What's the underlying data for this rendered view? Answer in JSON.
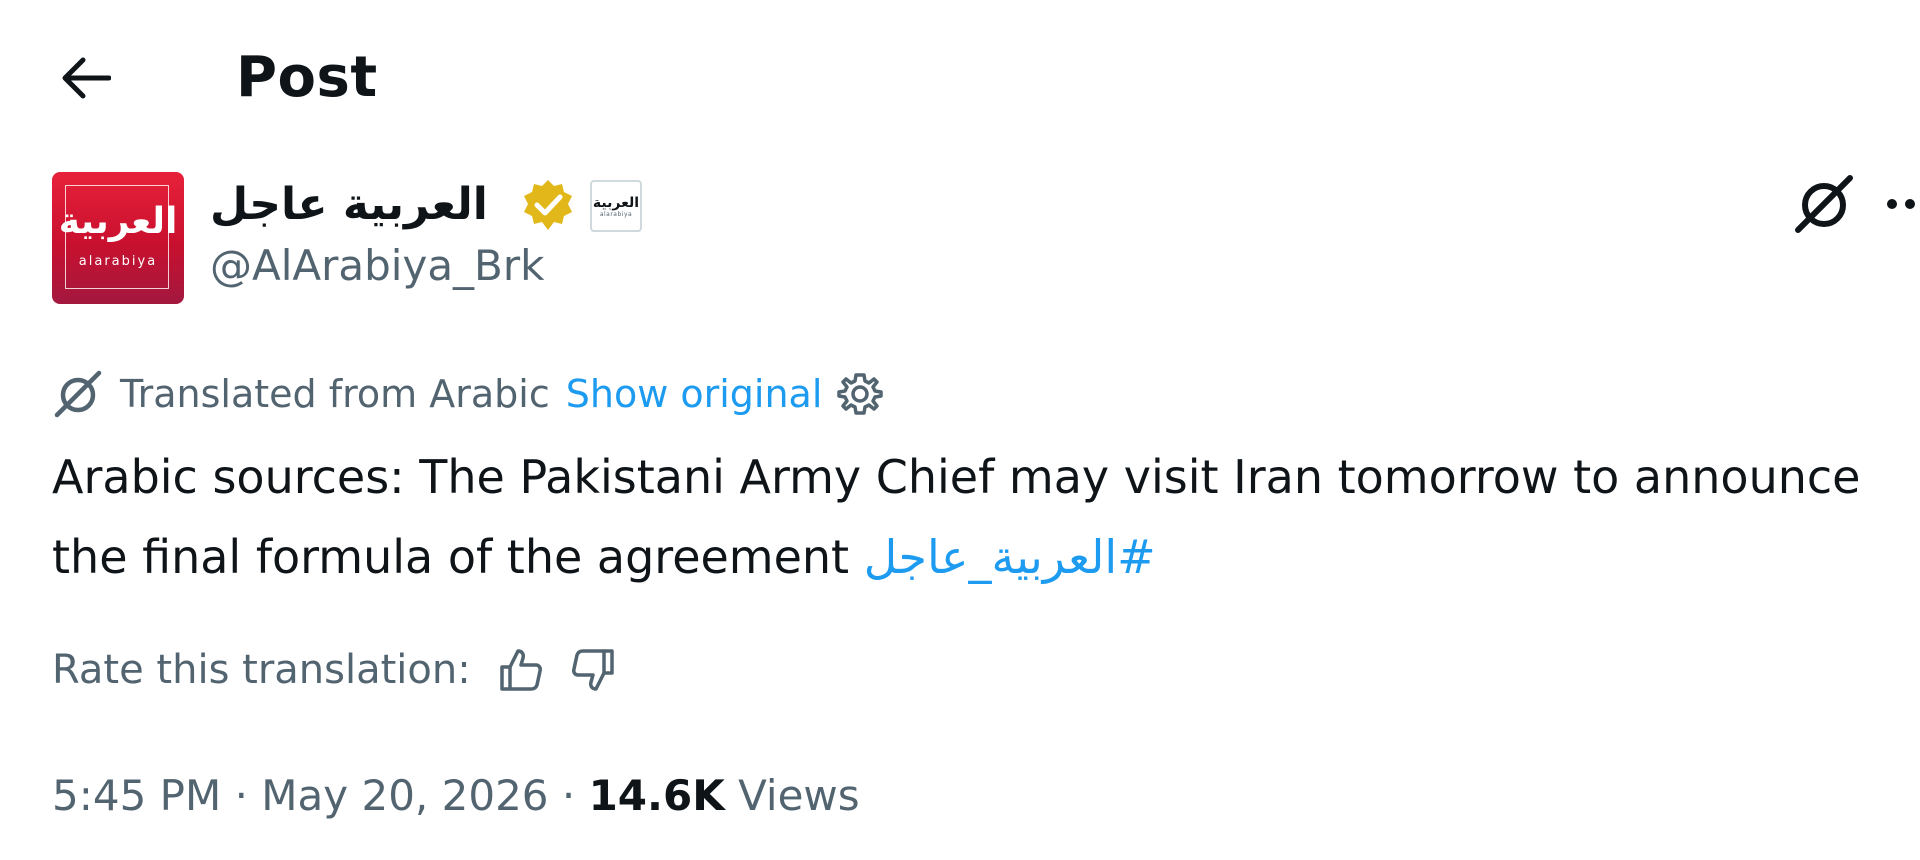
{
  "header": {
    "title": "Post",
    "back_icon": "arrow-left-icon"
  },
  "author": {
    "display_name": "العربية عاجل",
    "handle": "@AlArabiya_Brk",
    "avatar_text_ar": "العربية",
    "avatar_text_en": "alarabiya",
    "affiliate_badge_ar": "العربية",
    "affiliate_badge_en": "alarabiya",
    "verified_icon": "verified-badge-icon",
    "verified_color": "#e2b719",
    "avatar_color": "#d0142f"
  },
  "actions": {
    "grok_icon": "grok-icon",
    "more_icon": "more-horizontal-icon"
  },
  "translation": {
    "label": "Translated from Arabic",
    "show_original": "Show original",
    "settings_icon": "gear-icon"
  },
  "post": {
    "text": "Arabic sources: The Pakistani Army Chief may visit Iran tomorrow to announce the final formula of the agreement",
    "hashtag": "#العربية_عاجل",
    "link_color": "#1d9bf0"
  },
  "rating": {
    "label": "Rate this translation:",
    "thumbs_up_icon": "thumbs-up-icon",
    "thumbs_down_icon": "thumbs-down-icon"
  },
  "meta": {
    "time": "5:45 PM",
    "separator": " · ",
    "date": "May 20, 2026",
    "views_count": "14.6K",
    "views_label": "Views"
  }
}
